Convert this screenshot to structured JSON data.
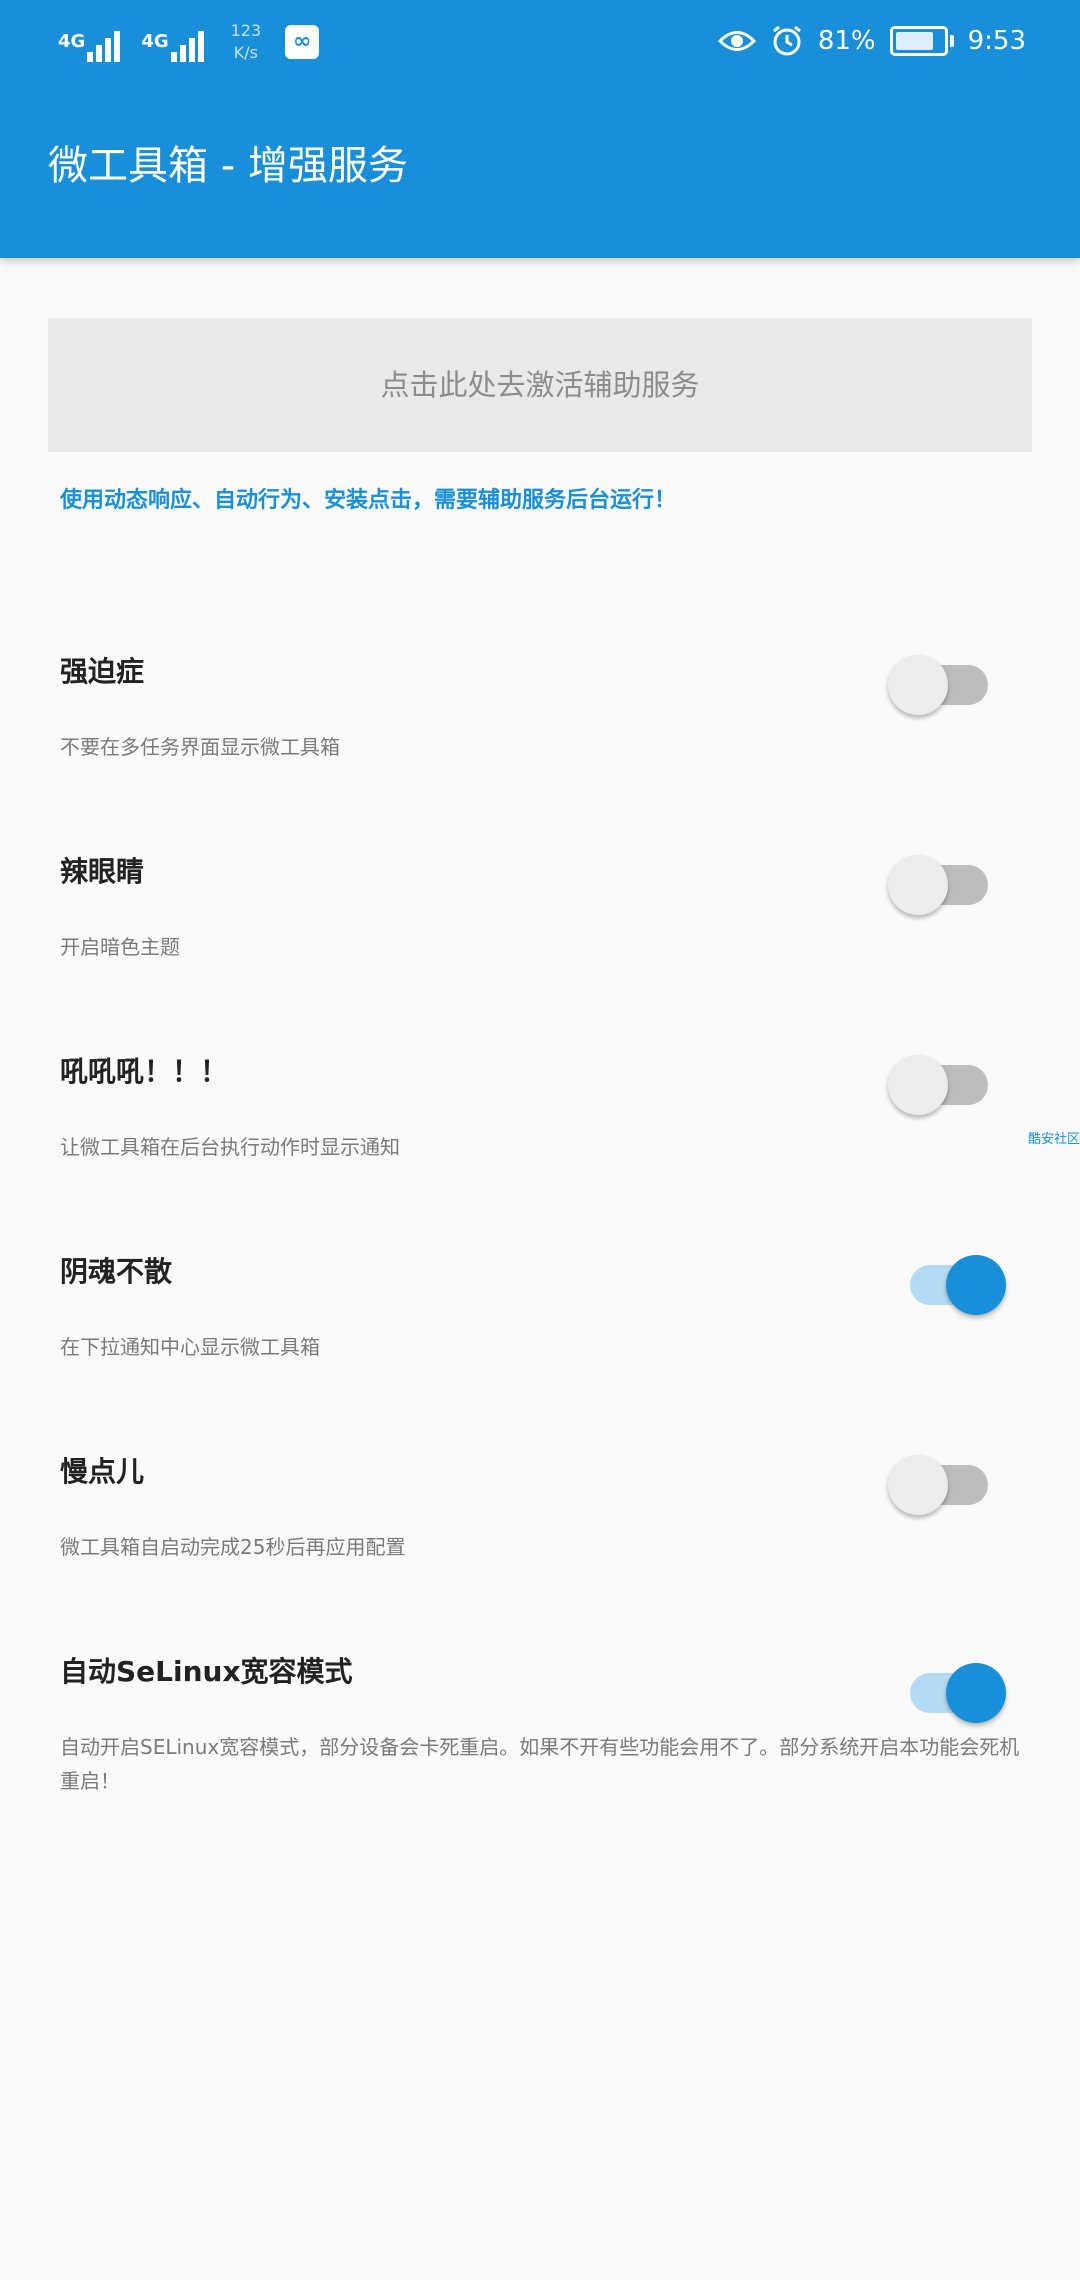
{
  "status_bar": {
    "network_1": "4G",
    "network_2": "4G",
    "speed_value": "123",
    "speed_unit": "K/s",
    "battery_percent_text": "81%",
    "battery_level": 0.81,
    "time": "9:53",
    "icons": [
      "signal-icon",
      "app-icon",
      "eye-icon",
      "alarm-icon",
      "battery-icon"
    ]
  },
  "toolbar": {
    "title": "微工具箱 - 增强服务"
  },
  "activate_button": {
    "label": "点击此处去激活辅助服务"
  },
  "hint_text": "使用动态响应、自动行为、安装点击，需要辅助服务后台运行！",
  "preferences": [
    {
      "title": "强迫症",
      "summary": "不要在多任务界面显示微工具箱",
      "enabled": false
    },
    {
      "title": "辣眼睛",
      "summary": "开启暗色主题",
      "enabled": false
    },
    {
      "title": "吼吼吼！！！",
      "summary": "让微工具箱在后台执行动作时显示通知",
      "enabled": false
    },
    {
      "title": "阴魂不散",
      "summary": "在下拉通知中心显示微工具箱",
      "enabled": true
    },
    {
      "title": "慢点儿",
      "summary": "微工具箱自启动完成25秒后再应用配置",
      "enabled": false
    },
    {
      "title": "自动SeLinux宽容模式",
      "summary": "自动开启SELinux宽容模式，部分设备会卡死重启。如果不开有些功能会用不了。部分系统开启本功能会死机重启！",
      "enabled": true
    }
  ],
  "edge_label": "酷安社区",
  "colors": {
    "accent": "#1a8fd9",
    "background": "#fafafa",
    "button_bg": "#e9e9e9",
    "switch_off_track": "#bdbdbd",
    "switch_on_track": "#b3daf3"
  }
}
